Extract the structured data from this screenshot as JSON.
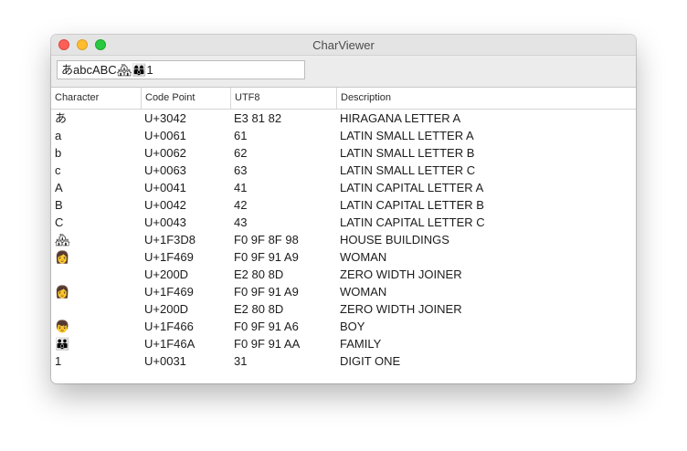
{
  "window": {
    "title": "CharViewer"
  },
  "input": {
    "value": "あabcABC🏘👩‍👩‍👦1"
  },
  "table": {
    "columns": [
      "Character",
      "Code Point",
      "UTF8",
      "Description"
    ],
    "rows": [
      {
        "char": "あ",
        "code": "U+3042",
        "utf8": "E3 81 82",
        "desc": "HIRAGANA LETTER A"
      },
      {
        "char": "a",
        "code": "U+0061",
        "utf8": "61",
        "desc": "LATIN SMALL LETTER A"
      },
      {
        "char": "b",
        "code": "U+0062",
        "utf8": "62",
        "desc": "LATIN SMALL LETTER B"
      },
      {
        "char": "c",
        "code": "U+0063",
        "utf8": "63",
        "desc": "LATIN SMALL LETTER C"
      },
      {
        "char": "A",
        "code": "U+0041",
        "utf8": "41",
        "desc": "LATIN CAPITAL LETTER A"
      },
      {
        "char": "B",
        "code": "U+0042",
        "utf8": "42",
        "desc": "LATIN CAPITAL LETTER B"
      },
      {
        "char": "C",
        "code": "U+0043",
        "utf8": "43",
        "desc": "LATIN CAPITAL LETTER C"
      },
      {
        "char": "🏘",
        "code": "U+1F3D8",
        "utf8": "F0 9F 8F 98",
        "desc": "HOUSE BUILDINGS"
      },
      {
        "char": "👩",
        "code": "U+1F469",
        "utf8": "F0 9F 91 A9",
        "desc": "WOMAN"
      },
      {
        "char": "",
        "code": "U+200D",
        "utf8": "E2 80 8D",
        "desc": "ZERO WIDTH JOINER"
      },
      {
        "char": "👩",
        "code": "U+1F469",
        "utf8": "F0 9F 91 A9",
        "desc": "WOMAN"
      },
      {
        "char": "",
        "code": "U+200D",
        "utf8": "E2 80 8D",
        "desc": "ZERO WIDTH JOINER"
      },
      {
        "char": "👦",
        "code": "U+1F466",
        "utf8": "F0 9F 91 A6",
        "desc": "BOY"
      },
      {
        "char": "👪",
        "code": "U+1F46A",
        "utf8": "F0 9F 91 AA",
        "desc": "FAMILY"
      },
      {
        "char": "1",
        "code": "U+0031",
        "utf8": "31",
        "desc": "DIGIT ONE"
      }
    ]
  }
}
